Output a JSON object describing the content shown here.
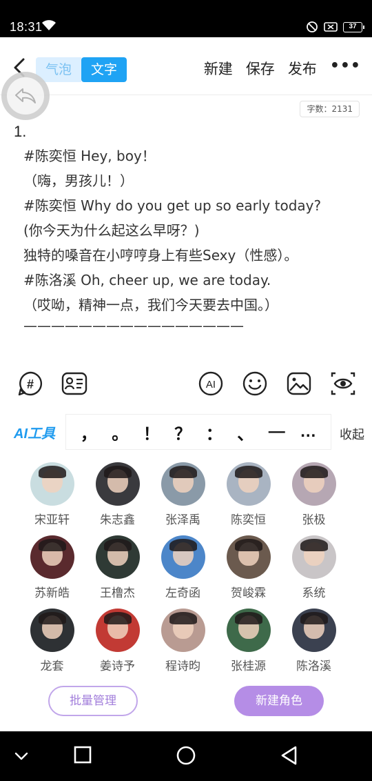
{
  "status_bar": {
    "time": "18:31",
    "battery": "37"
  },
  "header": {
    "tabs": [
      {
        "label": "气泡"
      },
      {
        "label": "文字"
      }
    ],
    "actions": {
      "new": "新建",
      "save": "保存",
      "publish": "发布",
      "more": "•••"
    }
  },
  "editor": {
    "word_count": "字数：2131",
    "line_number": "1.",
    "lines": [
      "#陈奕恒 Hey, boy！",
      "（嗨，男孩儿！）",
      "#陈奕恒 Why do you get up so early today?",
      "(你今天为什么起这么早呀？)",
      "独特的嗓音在小哼哼身上有些Sexy（性感）。",
      "#陈洛溪 Oh, cheer up, we are today.",
      "（哎呦，精神一点，我们今天要去中国。）",
      "————————————————"
    ]
  },
  "toolbar": {
    "ai_tools": "AI工具",
    "punctuation": [
      "，",
      "。",
      "！",
      "？",
      "：",
      "、",
      "—",
      "…"
    ],
    "collapse": "收起"
  },
  "characters": [
    {
      "name": "宋亚轩",
      "color": "#c9dde0"
    },
    {
      "name": "朱志鑫",
      "color": "#3a3a3e"
    },
    {
      "name": "张泽禹",
      "color": "#8a9aa8"
    },
    {
      "name": "陈奕恒",
      "color": "#a9b4c2"
    },
    {
      "name": "张极",
      "color": "#b6a7b3"
    },
    {
      "name": "苏新皓",
      "color": "#5a2a2e"
    },
    {
      "name": "王橹杰",
      "color": "#2f3a35"
    },
    {
      "name": "左奇函",
      "color": "#4c86c9"
    },
    {
      "name": "贺峻霖",
      "color": "#6b5a4e"
    },
    {
      "name": "系统",
      "color": "#c9c5c7"
    },
    {
      "name": "龙套",
      "color": "#2e3134"
    },
    {
      "name": "姜诗予",
      "color": "#c23a34"
    },
    {
      "name": "程诗昀",
      "color": "#b99b92"
    },
    {
      "name": "张桂源",
      "color": "#3e6a4a"
    },
    {
      "name": "陈洛溪",
      "color": "#3b4150"
    }
  ],
  "footer": {
    "batch_manage": "批量管理",
    "new_character": "新建角色"
  },
  "colors": {
    "accent_blue": "#1fa3f4",
    "accent_purple": "#b58de6"
  }
}
